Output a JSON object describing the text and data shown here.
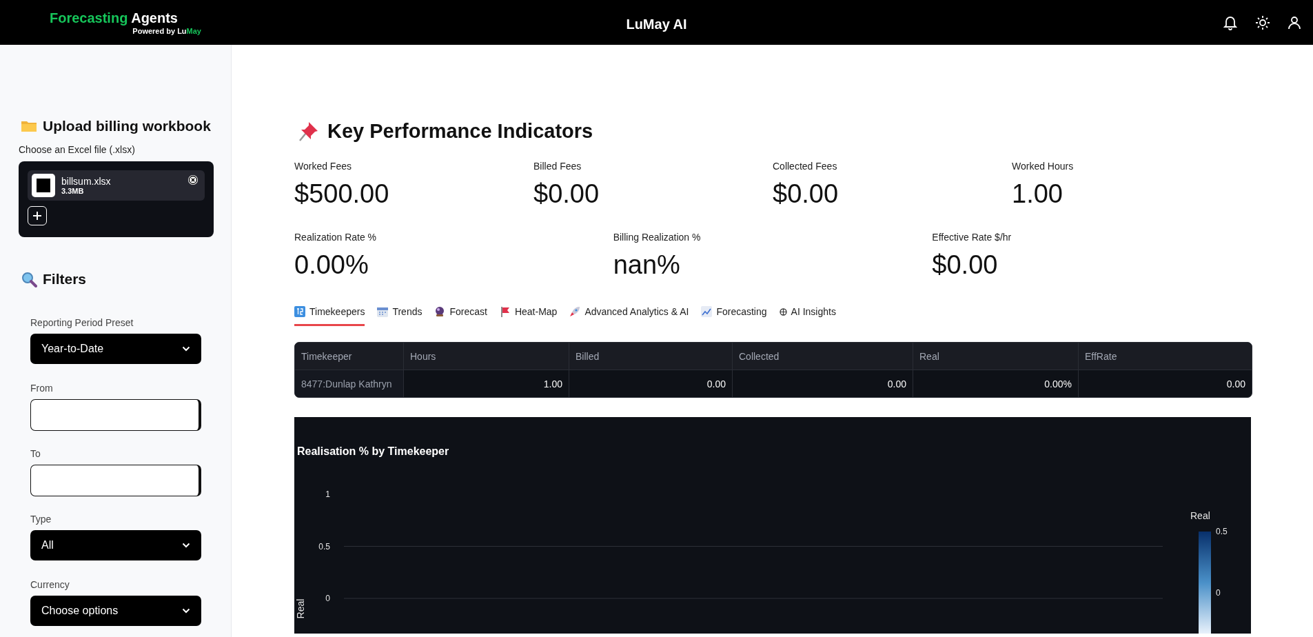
{
  "header": {
    "logo_title_parts": [
      "Forecasting",
      "Agents"
    ],
    "logo_tagline_parts": [
      "Powered by ",
      "Lu",
      "May"
    ],
    "app_title": "LuMay AI"
  },
  "sidebar": {
    "upload": {
      "heading": "Upload billing workbook",
      "label": "Choose an Excel file (.xlsx)",
      "file": {
        "name": "billsum.xlsx",
        "size": "3.3MB"
      }
    },
    "filters": {
      "heading": "Filters",
      "fields": [
        {
          "kind": "select",
          "label": "Reporting Period Preset",
          "value": "Year-to-Date"
        },
        {
          "kind": "date",
          "label": "From"
        },
        {
          "kind": "date",
          "label": "To"
        },
        {
          "kind": "select",
          "label": "Type",
          "value": "All"
        },
        {
          "kind": "select",
          "label": "Currency",
          "value": "Choose options"
        }
      ]
    }
  },
  "kpi": {
    "heading": "Key Performance Indicators",
    "row_1": [
      {
        "label": "Worked Fees",
        "value": "$500.00"
      },
      {
        "label": "Billed Fees",
        "value": "$0.00"
      },
      {
        "label": "Collected Fees",
        "value": "$0.00"
      },
      {
        "label": "Worked Hours",
        "value": "1.00"
      }
    ],
    "row_2": [
      {
        "label": "Realization Rate %",
        "value": "0.00%"
      },
      {
        "label": "Billing Realization %",
        "value": "nan%"
      },
      {
        "label": "Effective Rate $/hr",
        "value": "$0.00"
      }
    ]
  },
  "tabs": [
    {
      "label": "Timekeepers",
      "selected": true
    },
    {
      "label": "Trends",
      "selected": false
    },
    {
      "label": "Forecast",
      "selected": false
    },
    {
      "label": "Heat-Map",
      "selected": false
    },
    {
      "label": "Advanced Analytics & AI",
      "selected": false
    },
    {
      "label": "Forecasting",
      "selected": false
    },
    {
      "label": "AI Insights",
      "selected": false
    }
  ],
  "table": {
    "columns": [
      "Timekeeper",
      "Hours",
      "Billed",
      "Collected",
      "Real",
      "EffRate"
    ],
    "rows": [
      [
        "8477:Dunlap Kathryn",
        "1.00",
        "0.00",
        "0.00",
        "0.00%",
        "0.00"
      ]
    ]
  },
  "chart": {
    "title": "Realisation % by Timekeeper",
    "y_axis_title": "Real",
    "y_tick_labels": [
      "1",
      "0.5",
      "0"
    ],
    "colorbar": {
      "title": "Real",
      "ticks": [
        "0.5",
        "0"
      ]
    }
  }
}
